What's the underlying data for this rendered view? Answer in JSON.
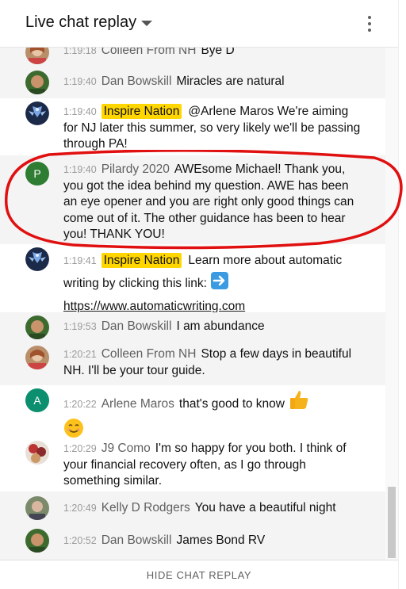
{
  "header": {
    "title": "Live chat replay"
  },
  "messages": [
    {
      "time": "1:19:18",
      "author": "Colleen From NH",
      "text": "Bye D"
    },
    {
      "time": "1:19:40",
      "author": "Dan Bowskill",
      "text": "Miracles are natural"
    },
    {
      "time": "1:19:40",
      "author": "Inspire Nation",
      "text": "@Arlene Maros We're aiming for NJ later this summer, so very likely we'll be passing through PA!"
    },
    {
      "time": "1:19:40",
      "author": "Pilardy 2020",
      "text": "AWEsome Michael! Thank you, you got the idea behind my question. AWE has been an eye opener and you are right only good things can come out of it. The other guidance has been to hear you! THANK YOU!",
      "avatar_letter": "P"
    },
    {
      "time": "1:19:41",
      "author": "Inspire Nation",
      "text": "Learn more about automatic writing by clicking this link:",
      "link": "https://www.automaticwriting.com"
    },
    {
      "time": "1:19:53",
      "author": "Dan Bowskill",
      "text": "I am abundance"
    },
    {
      "time": "1:20:21",
      "author": "Colleen From NH",
      "text": "Stop a few days in beautiful NH. I'll be your tour guide."
    },
    {
      "time": "1:20:22",
      "author": "Arlene Maros",
      "text": "that's good to know",
      "avatar_letter": "A"
    },
    {
      "time": "1:20:29",
      "author": "J9 Como",
      "text": "I'm so happy for you both. I think of your financial recovery often, as I go through something similar."
    },
    {
      "time": "1:20:49",
      "author": "Kelly D Rodgers",
      "text": "You have a beautiful night"
    },
    {
      "time": "1:20:52",
      "author": "Dan Bowskill",
      "text": "James Bond RV"
    }
  ],
  "footer": {
    "hide_label": "HIDE CHAT REPLAY"
  },
  "colors": {
    "owner_badge": "#ffd600",
    "annotation_ring": "#e01010",
    "avatar_p": "#2e7d32",
    "avatar_a": "#0b8f6f"
  },
  "icons": [
    "dropdown-arrow-icon",
    "more-vert-icon",
    "right-arrow-emoji",
    "thumbs-up-emoji",
    "smiling-face-emoji"
  ]
}
